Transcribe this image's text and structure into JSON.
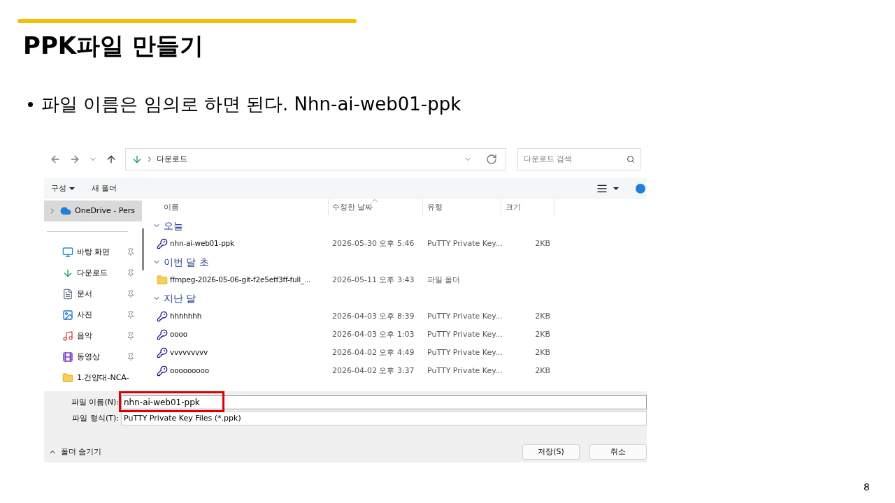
{
  "slide": {
    "title": "PPK파일 만들기",
    "bullet": "파일 이름은 임의로 하면 된다. Nhn-ai-web01-ppk",
    "page_number": "8"
  },
  "dialog": {
    "nav": {
      "path": "다운로드",
      "search_placeholder": "다운로드 검색"
    },
    "toolbar": {
      "organize": "구성",
      "new_folder": "새 폴더"
    },
    "sidebar": [
      {
        "kind": "cloud",
        "label": "OneDrive - Pers",
        "selected": true,
        "pinned": false
      },
      {
        "kind": "desktop",
        "label": "바탕 화면",
        "selected": false,
        "pinned": true
      },
      {
        "kind": "download",
        "label": "다운로드",
        "selected": false,
        "pinned": true
      },
      {
        "kind": "document",
        "label": "문서",
        "selected": false,
        "pinned": true
      },
      {
        "kind": "photo",
        "label": "사진",
        "selected": false,
        "pinned": true
      },
      {
        "kind": "music",
        "label": "음악",
        "selected": false,
        "pinned": true
      },
      {
        "kind": "video",
        "label": "동영상",
        "selected": false,
        "pinned": true
      },
      {
        "kind": "folder",
        "label": "1.건양대-NCA-",
        "selected": false,
        "pinned": false
      }
    ],
    "columns": [
      {
        "label": "이름",
        "sorted": false
      },
      {
        "label": "수정한 날짜",
        "sorted": true
      },
      {
        "label": "유형",
        "sorted": false
      },
      {
        "label": "크기",
        "sorted": false
      }
    ],
    "groups": [
      {
        "label": "오늘",
        "expanded": true,
        "files": [
          {
            "kind": "key",
            "name": "nhn-ai-web01-ppk",
            "date": "2026-05-30 오후 5:46",
            "type": "PuTTY Private Key...",
            "size": "2KB"
          }
        ]
      },
      {
        "label": "이번 달 초",
        "expanded": true,
        "files": [
          {
            "kind": "folder",
            "name": "ffmpeg-2026-05-06-git-f2e5eff3ff-full_...",
            "date": "2026-05-11 오후 3:43",
            "type": "파일 폴더"
          }
        ]
      },
      {
        "label": "지난 달",
        "expanded": true,
        "files": [
          {
            "kind": "key",
            "name": "hhhhhhh",
            "date": "2026-04-03 오후 8:39",
            "type": "PuTTY Private Key...",
            "size": "2KB"
          },
          {
            "kind": "key",
            "name": "oooo",
            "date": "2026-04-03 오후 1:03",
            "type": "PuTTY Private Key...",
            "size": "2KB"
          },
          {
            "kind": "key",
            "name": "vvvvvvvvv",
            "date": "2026-04-02 오후 4:49",
            "type": "PuTTY Private Key...",
            "size": "2KB"
          },
          {
            "kind": "key",
            "name": "ooooooooo",
            "date": "2026-04-02 오후 3:37",
            "type": "PuTTY Private Key...",
            "size": "2KB"
          }
        ]
      }
    ],
    "file_name": {
      "label": "파일 이름(N):",
      "value": "nhn-ai-web01-ppk",
      "highlighted": true
    },
    "file_type": {
      "label": "파일 형식(T):",
      "value": "PuTTY Private Key Files (*.ppk)"
    },
    "hide_folders": "폴더 숨기기",
    "buttons": [
      "저장(S)",
      "취소"
    ]
  }
}
